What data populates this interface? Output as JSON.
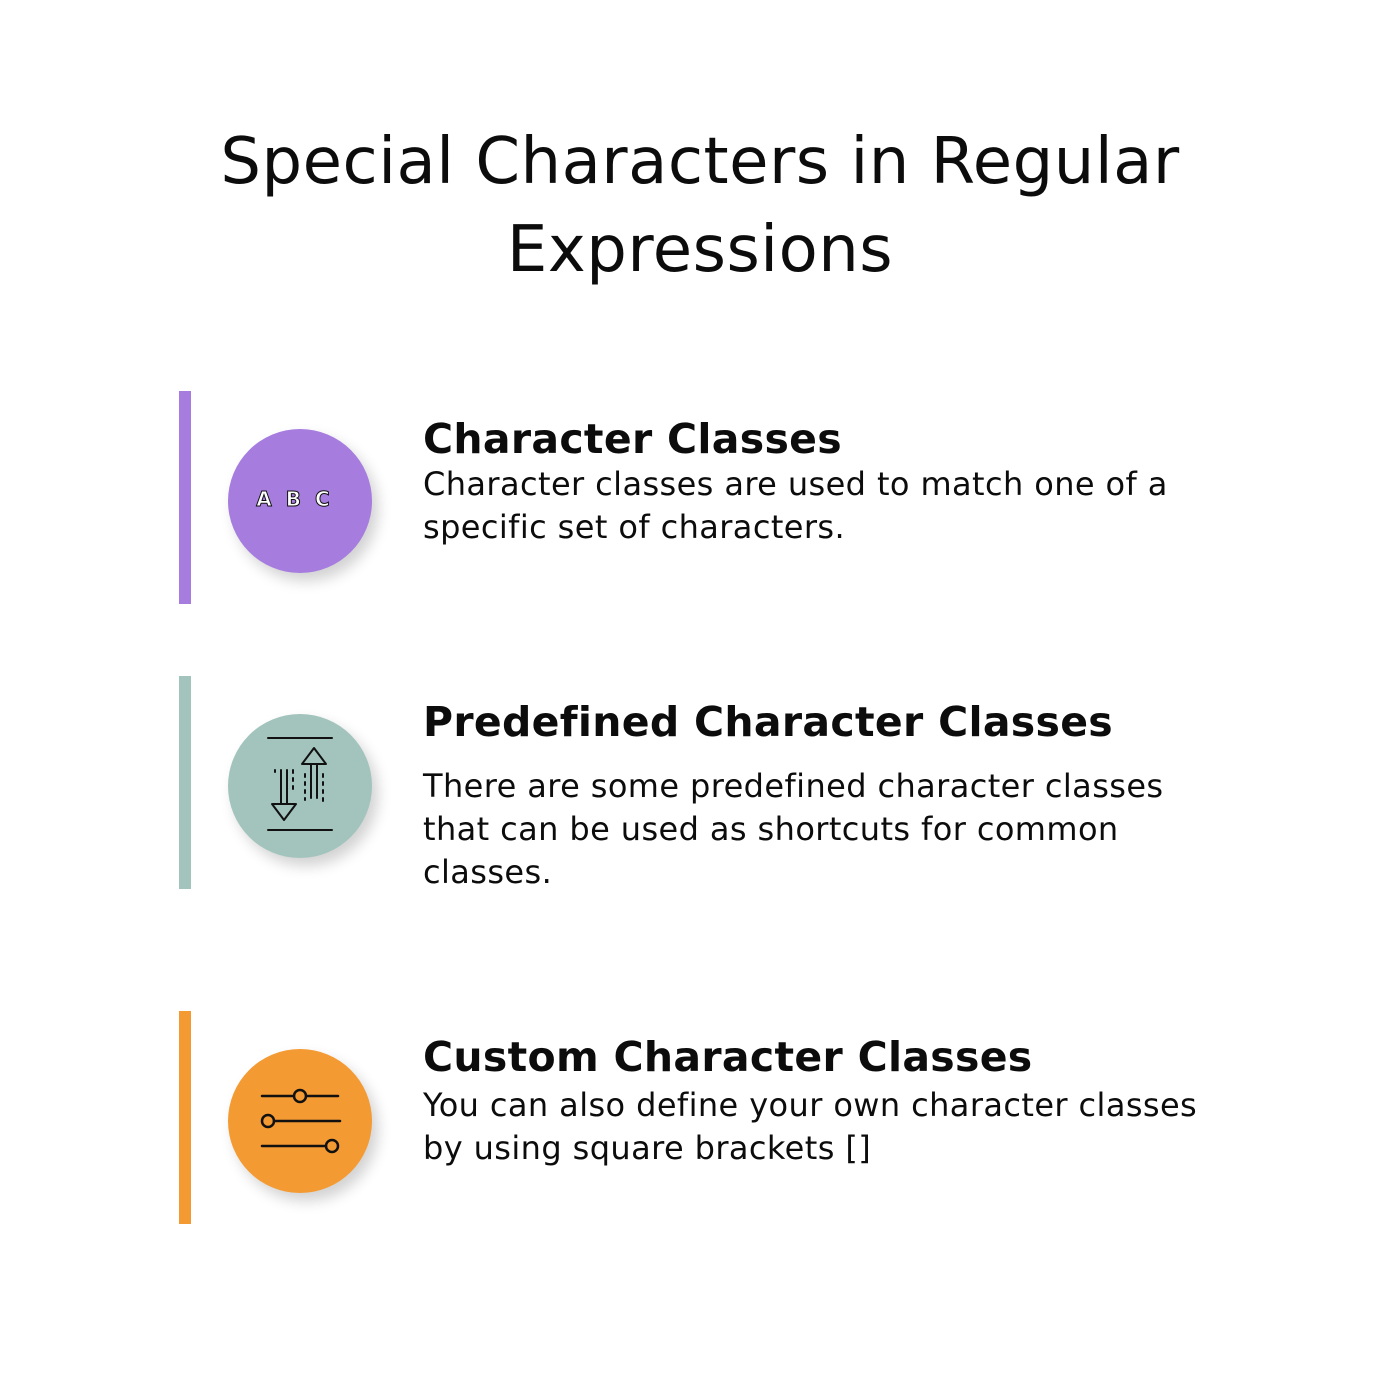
{
  "title": "Special Characters in Regular Expressions",
  "sections": [
    {
      "heading": "Character Classes",
      "text": "Character classes are used to match one of a specific set of characters.",
      "color": "#a67ddf",
      "bar_color": "#a67ddf",
      "icon": "abc-letters-icon",
      "icon_label": "ABC"
    },
    {
      "heading": "Predefined Character Classes",
      "text": "There are some predefined character classes that can be used as shortcuts for common classes.",
      "color": "#a2c4bd",
      "bar_color": "#a2c4bd",
      "icon": "sort-arrows-icon"
    },
    {
      "heading": "Custom Character Classes",
      "text": "You can also define your own character classes by using square brackets []",
      "color": "#f49a33",
      "bar_color": "#f49a33",
      "icon": "sliders-icon"
    }
  ]
}
